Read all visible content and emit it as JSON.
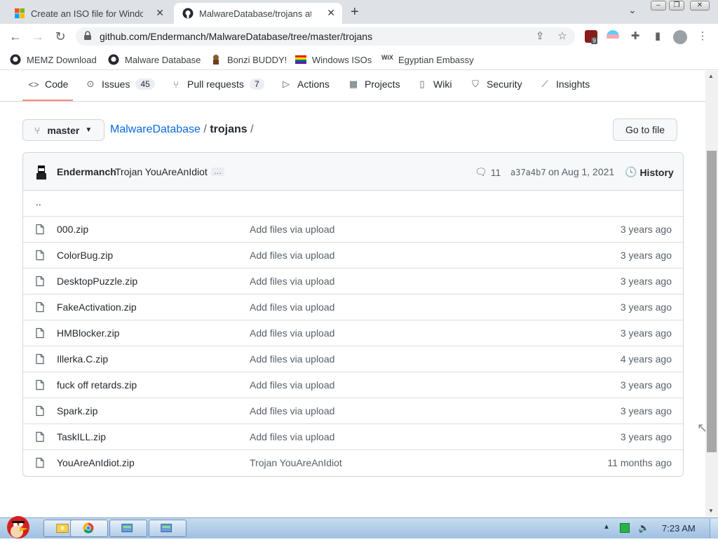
{
  "browser": {
    "tabs": [
      {
        "title": "Create an ISO file for Windows",
        "active": false
      },
      {
        "title": "MalwareDatabase/trojans at master",
        "active": true
      }
    ],
    "new_tab_symbol": "+",
    "tab_close_symbol": "✕",
    "url": "github.com/Endermanch/MalwareDatabase/tree/master/trojans",
    "extension_badge": "9",
    "bookmarks": [
      {
        "label": "MEMZ Download",
        "icon": "github-icon"
      },
      {
        "label": "Malware Database",
        "icon": "github-icon"
      },
      {
        "label": "Bonzi BUDDY!",
        "icon": "bonzi-icon"
      },
      {
        "label": "Windows ISOs",
        "icon": "rainbow-flag-icon"
      },
      {
        "label": "Egyptian Embassy",
        "icon": "wix-icon"
      }
    ]
  },
  "repo_nav": {
    "tabs": [
      {
        "label": "Code",
        "count": null,
        "icon": "code-icon"
      },
      {
        "label": "Issues",
        "count": "45",
        "icon": "issue-icon"
      },
      {
        "label": "Pull requests",
        "count": "7",
        "icon": "pull-request-icon"
      },
      {
        "label": "Actions",
        "count": null,
        "icon": "play-icon"
      },
      {
        "label": "Projects",
        "count": null,
        "icon": "table-icon"
      },
      {
        "label": "Wiki",
        "count": null,
        "icon": "book-icon"
      },
      {
        "label": "Security",
        "count": null,
        "icon": "shield-icon"
      },
      {
        "label": "Insights",
        "count": null,
        "icon": "graph-icon"
      }
    ]
  },
  "path": {
    "branch": "master",
    "repo": "MalwareDatabase",
    "sep": "/",
    "folder": "trojans",
    "trailing": "/",
    "goto_label": "Go to file"
  },
  "commit": {
    "author": "Endermanch",
    "message": "Trojan YouAreAnIdiot",
    "ellipsis": "…",
    "comments": "11",
    "sha": "a37a4b7",
    "date": "on Aug 1, 2021",
    "history_label": "History"
  },
  "parent_dir": "..",
  "files": [
    {
      "name": "000.zip",
      "message": "Add files via upload",
      "age": "3 years ago"
    },
    {
      "name": "ColorBug.zip",
      "message": "Add files via upload",
      "age": "3 years ago"
    },
    {
      "name": "DesktopPuzzle.zip",
      "message": "Add files via upload",
      "age": "3 years ago"
    },
    {
      "name": "FakeActivation.zip",
      "message": "Add files via upload",
      "age": "3 years ago"
    },
    {
      "name": "HMBlocker.zip",
      "message": "Add files via upload",
      "age": "3 years ago"
    },
    {
      "name": "Illerka.C.zip",
      "message": "Add files via upload",
      "age": "4 years ago"
    },
    {
      "name": "fuck off retards.zip",
      "message": "Add files via upload",
      "age": "3 years ago"
    },
    {
      "name": "Spark.zip",
      "message": "Add files via upload",
      "age": "3 years ago"
    },
    {
      "name": "TaskILL.zip",
      "message": "Add files via upload",
      "age": "3 years ago"
    },
    {
      "name": "YouAreAnIdiot.zip",
      "message": "Trojan YouAreAnIdiot",
      "age": "11 months ago"
    }
  ],
  "taskbar": {
    "clock": "7:23 AM"
  },
  "colors": {
    "link": "#0969da",
    "underline": "#fd8c73",
    "text": "#24292f",
    "muted": "#57606a"
  }
}
